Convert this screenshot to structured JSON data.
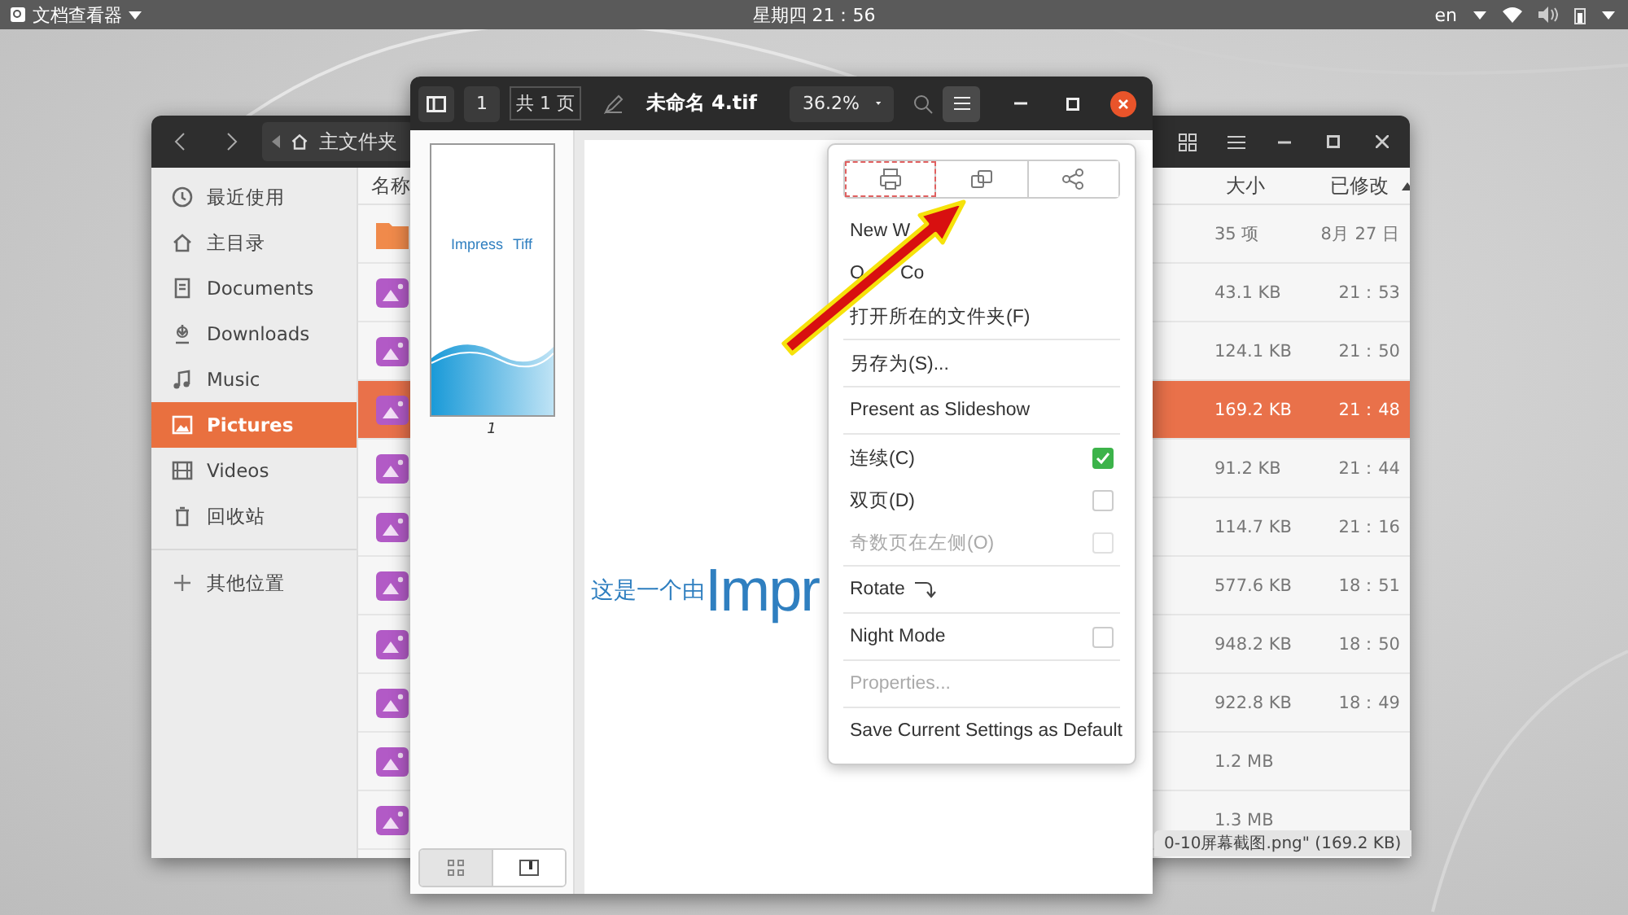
{
  "top_bar": {
    "app_menu": "文档查看器",
    "clock": "星期四 21：56",
    "input_method": "en"
  },
  "file_manager": {
    "path": "主文件夹",
    "sidebar": [
      {
        "label": "最近使用",
        "selected": false
      },
      {
        "label": "主目录",
        "selected": false
      },
      {
        "label": "Documents",
        "selected": false
      },
      {
        "label": "Downloads",
        "selected": false
      },
      {
        "label": "Music",
        "selected": false
      },
      {
        "label": "Pictures",
        "selected": true
      },
      {
        "label": "Videos",
        "selected": false
      },
      {
        "label": "回收站",
        "selected": false
      }
    ],
    "other_places": "其他位置",
    "columns": [
      "名称",
      "大小",
      "已修改"
    ],
    "rows": [
      {
        "kind": "folder",
        "size": "35 项",
        "modified": "8月 27 日",
        "selected": false
      },
      {
        "kind": "image",
        "size": "43.1 KB",
        "modified": "21：53",
        "selected": false
      },
      {
        "kind": "image",
        "size": "124.1 KB",
        "modified": "21：50",
        "selected": false
      },
      {
        "kind": "image",
        "size": "169.2 KB",
        "modified": "21：48",
        "selected": true
      },
      {
        "kind": "image",
        "size": "91.2 KB",
        "modified": "21：44",
        "selected": false
      },
      {
        "kind": "image",
        "size": "114.7 KB",
        "modified": "21：16",
        "selected": false
      },
      {
        "kind": "image",
        "size": "577.6 KB",
        "modified": "18：51",
        "selected": false
      },
      {
        "kind": "image",
        "size": "948.2 KB",
        "modified": "18：50",
        "selected": false
      },
      {
        "kind": "image",
        "size": "922.8 KB",
        "modified": "18：49",
        "selected": false
      },
      {
        "kind": "image",
        "size": "1.2 MB",
        "selected": false
      },
      {
        "kind": "image",
        "size": "1.3 MB",
        "selected": false
      }
    ],
    "status": "0-10屏幕截图.png\" (169.2 KB)"
  },
  "document_viewer": {
    "title": "未命名 4.tif",
    "page": "1",
    "page_count": "共 1 页",
    "zoom": "36.2%",
    "thumbnail_words": [
      "Impress",
      "Tiff"
    ],
    "thumbnail_label": "1",
    "page_words": [
      "这是一个由",
      "Impr"
    ],
    "menu": {
      "buttons": [
        {
          "focused": true
        },
        {
          "focused": false
        },
        {
          "focused": false
        }
      ],
      "sections": [
        [
          {
            "kind": "action",
            "label": "New W",
            "disabled": false
          },
          {
            "kind": "action",
            "label": "O",
            "label_2": "Co",
            "disabled": false
          },
          {
            "kind": "action",
            "label": "打开所在的文件夹(F)",
            "disabled": false
          }
        ],
        [
          {
            "kind": "action",
            "label": "另存为(S)...",
            "disabled": false
          }
        ],
        [
          {
            "kind": "action",
            "label": "Present as Slideshow",
            "disabled": false
          }
        ],
        [
          {
            "kind": "check",
            "label": "连续(C)",
            "checked": true,
            "disabled": false
          },
          {
            "kind": "check",
            "label": "双页(D)",
            "checked": false,
            "disabled": false
          },
          {
            "kind": "check",
            "label": "奇数页在左侧(O)",
            "checked": false,
            "disabled": true
          }
        ],
        [
          {
            "kind": "rotate",
            "label": "Rotate",
            "disabled": false
          }
        ],
        [
          {
            "kind": "check",
            "label": "Night Mode",
            "checked": false,
            "disabled": false
          }
        ],
        [
          {
            "kind": "action",
            "label": "Properties...",
            "disabled": true
          }
        ],
        [
          {
            "kind": "action",
            "label": "Save Current Settings as Default",
            "disabled": false
          }
        ]
      ]
    }
  }
}
